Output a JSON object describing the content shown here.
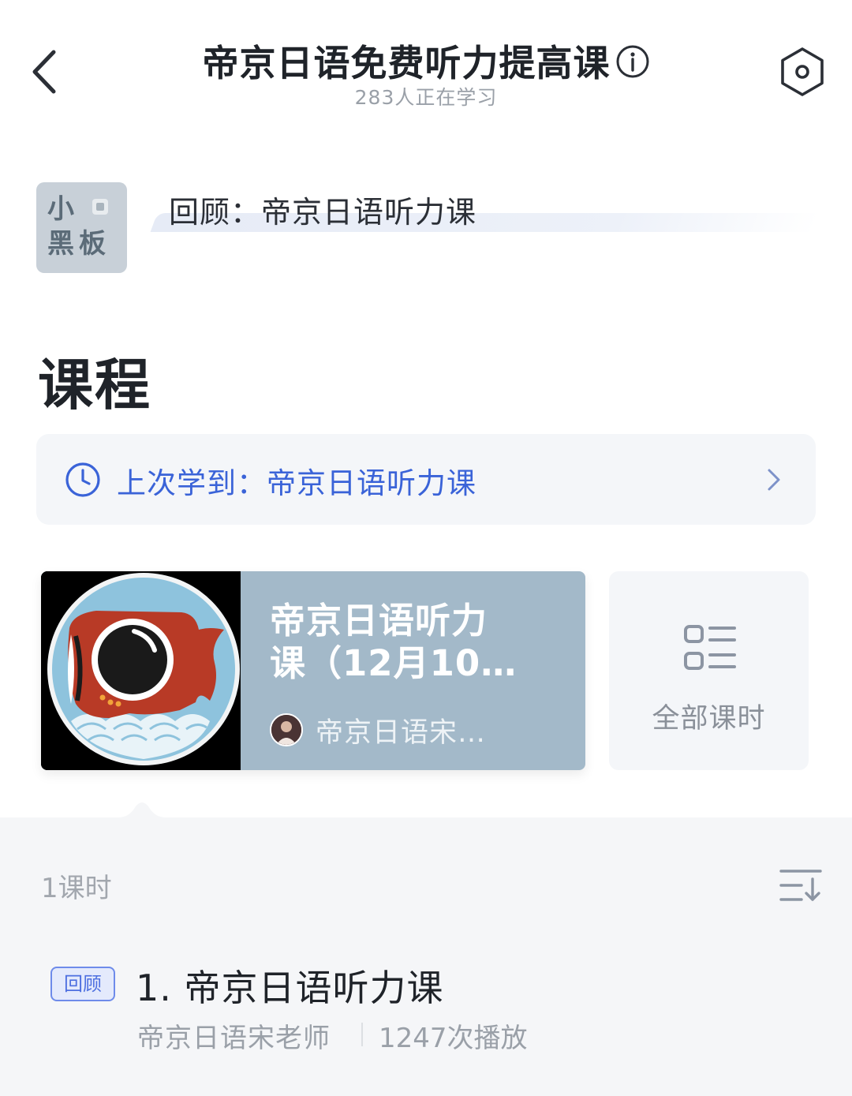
{
  "header": {
    "title": "帝京日语免费听力提高课",
    "subtitle": "283人正在学习",
    "back_icon": "chevron-left-icon",
    "info_icon": "info-circle-icon",
    "settings_icon": "hexagon-settings-icon"
  },
  "blackboard": {
    "line1": "小",
    "line2": "黑板",
    "review_text": "回顾：帝京日语听力课"
  },
  "section": {
    "title": "课程"
  },
  "last_learned": {
    "label": "上次学到：帝京日语听力课",
    "icon": "clock-icon",
    "accent": "#3a63d8"
  },
  "course_card": {
    "title_line1": "帝京日语听力",
    "title_line2": "课（12月10…",
    "teacher": "帝京日语宋…",
    "bg_color": "#a3b9c9"
  },
  "all_lessons": {
    "label": "全部课时",
    "icon": "list-icon"
  },
  "lessons": {
    "count_label": "1课时",
    "sort_icon": "sort-icon",
    "items": [
      {
        "tag": "回顾",
        "title": "1. 帝京日语听力课",
        "teacher": "帝京日语宋老师",
        "plays": "1247次播放"
      }
    ]
  }
}
